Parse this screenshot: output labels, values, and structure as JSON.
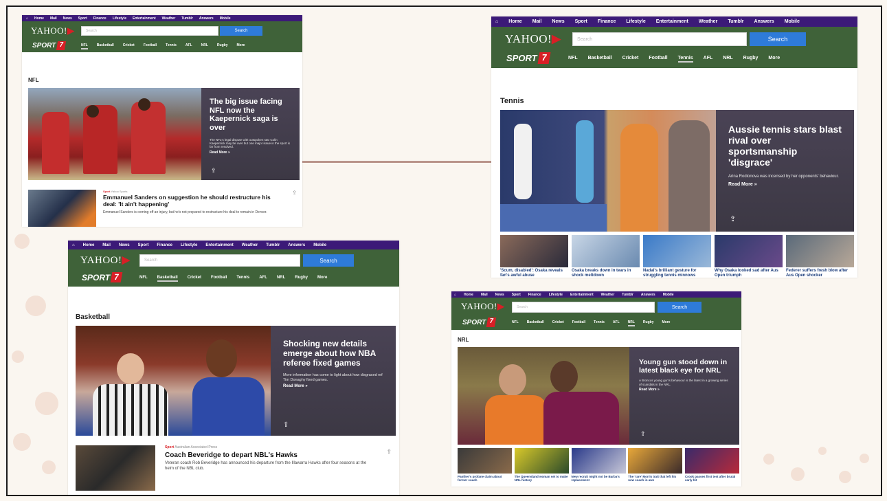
{
  "nav": {
    "items": [
      "Home",
      "Mail",
      "News",
      "Sport",
      "Finance",
      "Lifestyle",
      "Entertainment",
      "Weather",
      "Tumblr",
      "Answers",
      "Mobile"
    ],
    "logo": "YAHOO!",
    "sport_logo": "SPORT",
    "sport_num": "7",
    "search_placeholder": "Search",
    "search_button": "Search",
    "sport_nav": [
      "NFL",
      "Basketball",
      "Cricket",
      "Football",
      "Tennis",
      "AFL",
      "NRL",
      "Rugby",
      "More"
    ]
  },
  "nfl": {
    "section": "NFL",
    "hero_title": "The big issue facing NFL now the Kaepernick saga is over",
    "hero_desc": "The NFL's legal dispute with outspoken star Colin Kaepernick may be over but one major issue in the sport is far from resolved.",
    "read_more": "Read More »",
    "story_tag": "Sport",
    "story_src": "Yahoo Sports",
    "story_title": "Emmanuel Sanders on suggestion he should restructure his deal: 'It ain't happening'",
    "story_desc": "Emmanuel Sanders is coming off an injury, but he's not prepared to restructure his deal to remain in Denver."
  },
  "tennis": {
    "section": "Tennis",
    "hero_title": "Aussie tennis stars blast rival over sportsmanship 'disgrace'",
    "hero_desc": "Arina Rodionova was incensed by her opponents' behaviour.",
    "read_more": "Read More »",
    "thumbs": [
      "'Scum, disabled': Osaka reveals fan's awful abuse",
      "Osaka breaks down in tears in shock meltdown",
      "Nadal's brilliant gesture for struggling tennis minnows",
      "Why Osaka looked sad after Aus Open triumph",
      "Federer suffers fresh blow after Aus Open shocker"
    ]
  },
  "basketball": {
    "section": "Basketball",
    "hero_title": "Shocking new details emerge about how NBA referee fixed games",
    "hero_desc": "More information has come to light about how disgraced ref Tim Donaghy fixed games.",
    "read_more": "Read More »",
    "story_tag": "Sport",
    "story_src": "Australian Associated Press",
    "story_title": "Coach Beveridge to depart NBL's Hawks",
    "story_desc": "Veteran coach Rob Beveridge has announced his departure from the Illawarra Hawks after four seasons at the helm of the NBL club."
  },
  "nrl": {
    "section": "NRL",
    "hero_title": "Young gun stood down in latest black eye for NRL",
    "hero_desc": "A Broncos young gun's behaviour is the latest in a growing series of scandals in the NRL.",
    "read_more": "Read More »",
    "thumbs": [
      "Panther's profane claim about former coach",
      "The Queensland woman set to make NRL history",
      "New recruit might not be Barba's replacement",
      "The 'rare' Morris trait that left his new coach in awe",
      "Crook passes first test after brutal early hit"
    ]
  },
  "colors": {
    "topnav": "#3c1a78",
    "header": "#3f6239",
    "search_button": "#2e7bd9",
    "accent": "#d81f26"
  }
}
